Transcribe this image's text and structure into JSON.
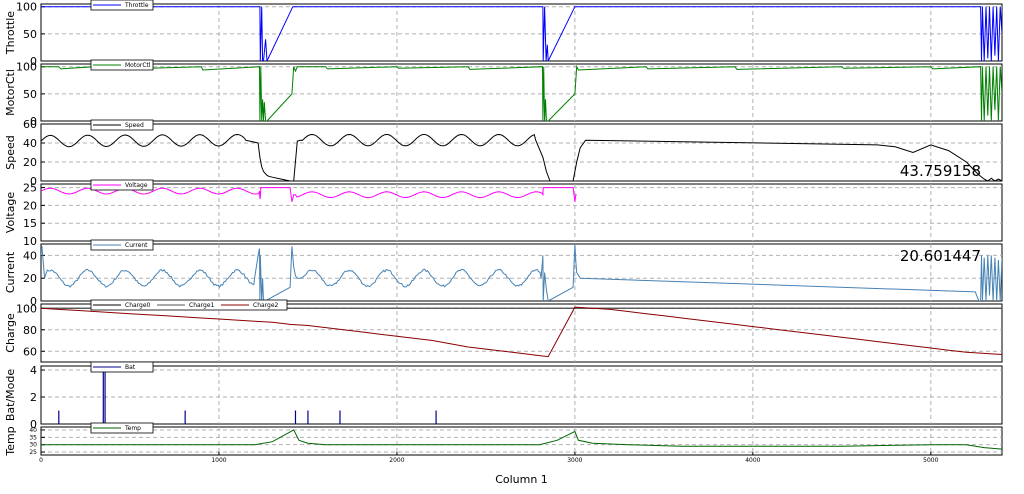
{
  "chart_data": {
    "type": "line",
    "xlabel": "Column 1",
    "xlim": [
      0,
      5400
    ],
    "x_ticks": [
      0,
      1000,
      2000,
      3000,
      4000,
      5000
    ],
    "x_tick_labels": [
      "0",
      "1000",
      "2000",
      "3000",
      "4000",
      "5000"
    ],
    "grid": true,
    "panels": [
      {
        "ylabel": "Throttle",
        "ylim": [
          0,
          105
        ],
        "y_ticks": [
          0,
          50,
          100
        ],
        "y_tick_labels": [
          "0",
          "50",
          "100"
        ],
        "legend": [
          "Throttle"
        ],
        "colors": [
          "#0000ff"
        ],
        "series": [
          {
            "name": "Throttle",
            "x": [
              0,
              1230,
              1232,
              1240,
              1245,
              1250,
              1262,
              1270,
              1415,
              1418,
              2820,
              2822,
              2830,
              2838,
              2845,
              2850,
              3000,
              3005,
              5280,
              5285,
              5290,
              5300,
              5310,
              5320,
              5330,
              5340,
              5350,
              5360,
              5370,
              5380,
              5390,
              5400
            ],
            "y": [
              100,
              100,
              0,
              100,
              0,
              0,
              40,
              0,
              100,
              100,
              100,
              0,
              100,
              0,
              30,
              0,
              100,
              100,
              100,
              0,
              100,
              0,
              100,
              5,
              100,
              0,
              100,
              10,
              100,
              0,
              100,
              50
            ]
          }
        ]
      },
      {
        "ylabel": "MotorCtl",
        "ylim": [
          0,
          105
        ],
        "y_ticks": [
          0,
          50,
          100
        ],
        "y_tick_labels": [
          "0",
          "50",
          "100"
        ],
        "legend": [
          "MotorCtl"
        ],
        "colors": [
          "#008000"
        ],
        "series": [
          {
            "name": "MotorCtl",
            "x": [
              0,
              100,
              110,
              300,
              310,
              600,
              610,
              900,
              910,
              1228,
              1230,
              1235,
              1240,
              1245,
              1250,
              1255,
              1262,
              1270,
              1410,
              1420,
              1430,
              1440,
              1600,
              1610,
              2000,
              2010,
              2400,
              2410,
              2818,
              2820,
              2825,
              2830,
              2835,
              2840,
              2850,
              3000,
              3010,
              3020,
              3400,
              3410,
              3900,
              3910,
              4500,
              4510,
              5000,
              5010,
              5280,
              5285,
              5290,
              5300,
              5310,
              5320,
              5330,
              5340,
              5350,
              5360,
              5370,
              5380,
              5390,
              5400
            ],
            "y": [
              100,
              100,
              96,
              100,
              95,
              100,
              97,
              100,
              94,
              100,
              0,
              100,
              0,
              40,
              0,
              35,
              0,
              0,
              50,
              100,
              92,
              100,
              100,
              96,
              100,
              97,
              100,
              95,
              100,
              0,
              100,
              0,
              40,
              0,
              0,
              50,
              100,
              94,
              100,
              96,
              100,
              95,
              100,
              97,
              100,
              96,
              100,
              0,
              100,
              0,
              100,
              10,
              100,
              0,
              100,
              20,
              100,
              0,
              100,
              50
            ]
          }
        ]
      },
      {
        "ylabel": "Speed",
        "ylim": [
          0,
          60
        ],
        "y_ticks": [
          0,
          20,
          40,
          60
        ],
        "y_tick_labels": [
          "0",
          "20",
          "40",
          "60"
        ],
        "legend": [
          "Speed"
        ],
        "colors": [
          "#000000"
        ],
        "annotation": "43.759158",
        "series": [
          {
            "name": "Speed",
            "x": [
              0,
              1150,
              1220,
              1230,
              1240,
              1250,
              1260,
              1270,
              1280,
              1300,
              1350,
              1400,
              1420,
              1440,
              1460,
              2780,
              2820,
              2840,
              2860,
              2900,
              2960,
              2990,
              3010,
              3030,
              3060,
              4700,
              4800,
              4900,
              5000,
              5100,
              5200,
              5250,
              5280,
              5300,
              5320,
              5340,
              5360,
              5380,
              5400
            ],
            "y": [
              42,
              43,
              40,
              25,
              15,
              10,
              8,
              6,
              5,
              4,
              2,
              0,
              0,
              42,
              43,
              43,
              25,
              10,
              0,
              0,
              0,
              0,
              20,
              35,
              43,
              38,
              36,
              30,
              38,
              32,
              20,
              10,
              5,
              2,
              0,
              3,
              0,
              2,
              0
            ]
          }
        ]
      },
      {
        "ylabel": "Voltage",
        "ylim": [
          10,
          26
        ],
        "y_ticks": [
          10,
          15,
          20,
          25
        ],
        "y_tick_labels": [
          "10",
          "15",
          "20",
          "25"
        ],
        "legend": [
          "Voltage"
        ],
        "colors": [
          "#ff00ff"
        ],
        "series": [
          {
            "name": "Voltage",
            "x": [
              0,
              1228,
              1230,
              1232,
              1235,
              1400,
              1410,
              1420,
              1430,
              2820,
              2822,
              2825,
              2990,
              3000,
              3005,
              3010
            ],
            "y": [
              24,
              24,
              22,
              22,
              25,
              25,
              21,
              23,
              23,
              23,
              25,
              25,
              25,
              21,
              23,
              23
            ]
          }
        ]
      },
      {
        "ylabel": "Current",
        "ylim": [
          0,
          50
        ],
        "y_ticks": [
          0,
          20,
          40
        ],
        "y_tick_labels": [
          "0",
          "20",
          "40"
        ],
        "legend": [
          "Current"
        ],
        "colors": [
          "#4682b4"
        ],
        "annotation": "20.601447",
        "series": [
          {
            "name": "Current",
            "x": [
              0,
              5,
              20,
              1200,
              1220,
              1228,
              1230,
              1232,
              1240,
              1245,
              1250,
              1260,
              1400,
              1410,
              1420,
              1430,
              1440,
              1460,
              2810,
              2820,
              2822,
              2830,
              2840,
              2850,
              2990,
              3000,
              3005,
              3010,
              3030,
              5250,
              5270,
              5280,
              5285,
              5290,
              5300,
              5310,
              5320,
              5330,
              5340,
              5350,
              5360,
              5370,
              5380,
              5390,
              5400
            ],
            "y": [
              40,
              48,
              20,
              20,
              40,
              46,
              0,
              40,
              0,
              20,
              0,
              0,
              12,
              48,
              30,
              22,
              20,
              20,
              20,
              40,
              0,
              25,
              10,
              0,
              12,
              50,
              35,
              25,
              20,
              8,
              0,
              0,
              40,
              0,
              38,
              0,
              40,
              5,
              40,
              0,
              38,
              0,
              36,
              0,
              38
            ]
          }
        ]
      },
      {
        "ylabel": "Charge",
        "ylim": [
          50,
          104
        ],
        "y_ticks": [
          60,
          80,
          100
        ],
        "y_tick_labels": [
          "60",
          "80",
          "100"
        ],
        "legend": [
          "Charge0",
          "Charge1",
          "Charge2"
        ],
        "colors": [
          "#000000",
          "#555555",
          "#8b0000"
        ],
        "series": [
          {
            "name": "Charge0",
            "x": [
              0,
              5400
            ],
            "y": [
              100,
              100
            ]
          },
          {
            "name": "Charge1",
            "x": [
              0,
              5400
            ],
            "y": [
              100,
              100
            ]
          },
          {
            "name": "Charge2",
            "x": [
              0,
              100,
              200,
              300,
              400,
              500,
              600,
              700,
              800,
              900,
              1000,
              1100,
              1200,
              1300,
              1400,
              1500,
              1600,
              1700,
              1800,
              1900,
              2000,
              2100,
              2200,
              2300,
              2400,
              2500,
              2600,
              2700,
              2800,
              2850,
              3000,
              3100,
              3200,
              3300,
              3400,
              3500,
              3600,
              3700,
              3800,
              3900,
              4000,
              4100,
              4200,
              4300,
              4400,
              4500,
              4600,
              4700,
              4800,
              4900,
              5000,
              5100,
              5200,
              5300,
              5400
            ],
            "y": [
              100,
              99,
              98,
              97,
              96,
              95,
              94,
              93,
              92,
              91,
              90,
              89,
              88,
              87,
              85,
              84,
              82,
              80,
              78,
              76,
              74,
              72,
              70,
              67,
              64,
              62,
              60,
              58,
              56,
              55,
              101,
              100,
              99,
              97,
              95,
              93,
              91,
              89,
              87,
              85,
              83,
              81,
              79,
              77,
              75,
              73,
              71,
              69,
              67,
              65,
              63,
              61,
              59,
              58,
              57
            ]
          }
        ]
      },
      {
        "ylabel": "Bat/Mode",
        "ylim": [
          0,
          4.3
        ],
        "y_ticks": [
          0,
          2,
          4
        ],
        "y_tick_labels": [
          "0",
          "2",
          "4"
        ],
        "legend": [
          "Bat"
        ],
        "colors": [
          "#00008b"
        ],
        "spikes": {
          "x": [
            100,
            350,
            360,
            810,
            1430,
            1500,
            1680,
            2220
          ],
          "y": [
            1,
            4,
            4,
            1,
            1,
            1,
            1,
            1
          ]
        }
      },
      {
        "ylabel": "Temp",
        "ylim": [
          23,
          42
        ],
        "y_ticks": [
          25,
          30,
          35,
          40
        ],
        "y_tick_labels": [
          "25",
          "30",
          "35",
          "40"
        ],
        "legend": [
          "Temp"
        ],
        "colors": [
          "#006400"
        ],
        "series": [
          {
            "name": "Temp",
            "x": [
              0,
              500,
              1000,
              1200,
              1300,
              1420,
              1450,
              1500,
              1600,
              2000,
              2500,
              2800,
              2900,
              3000,
              3020,
              3100,
              3300,
              3600,
              4000,
              4500,
              5000,
              5200,
              5300,
              5400
            ],
            "y": [
              30,
              30,
              30,
              30,
              32,
              40,
              33,
              31,
              30,
              30,
              30,
              30,
              33,
              39,
              33,
              31,
              30,
              29,
              29,
              29,
              30,
              30,
              28,
              27
            ]
          }
        ]
      }
    ]
  }
}
